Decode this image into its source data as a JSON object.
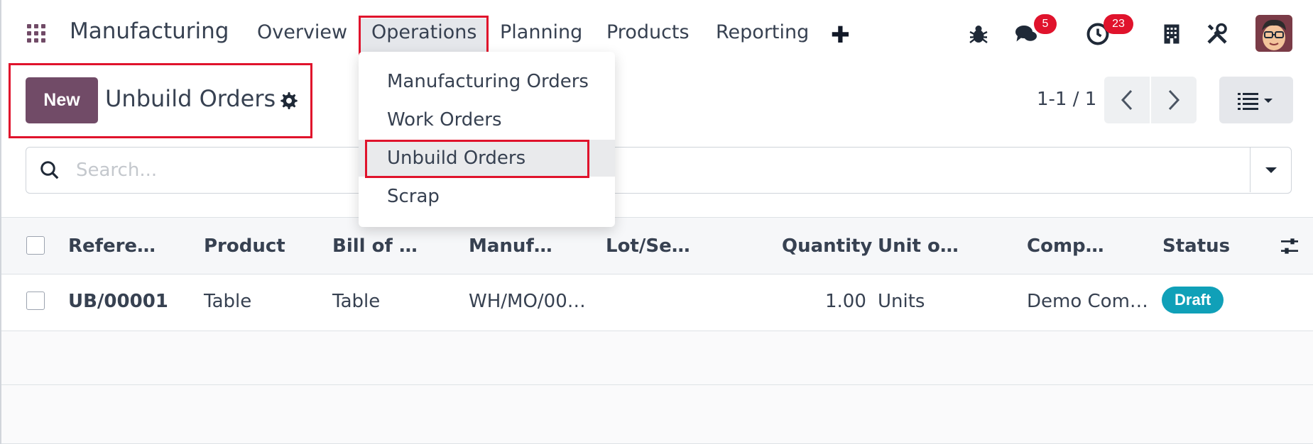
{
  "navbar": {
    "brand": "Manufacturing",
    "menu": [
      "Overview",
      "Operations",
      "Planning",
      "Products",
      "Reporting"
    ],
    "active_menu": "Operations",
    "messages_badge": "5",
    "activities_badge": "23"
  },
  "operations_menu": {
    "items": [
      "Manufacturing Orders",
      "Work Orders",
      "Unbuild Orders",
      "Scrap"
    ],
    "highlighted": "Unbuild Orders"
  },
  "control_panel": {
    "new_label": "New",
    "title": "Unbuild Orders",
    "pager": "1-1 / 1"
  },
  "search": {
    "placeholder": "Search..."
  },
  "table": {
    "columns": [
      "Refere…",
      "Product",
      "Bill of …",
      "Manuf…",
      "Lot/Se…",
      "Quantity",
      "Unit o…",
      "Comp…",
      "Status"
    ],
    "rows": [
      {
        "reference": "UB/00001",
        "product": "Table",
        "bom": "Table",
        "mo": "WH/MO/00…",
        "lot": "",
        "quantity": "1.00",
        "uom": "Units",
        "company": "Demo Com…",
        "status": "Draft"
      }
    ]
  },
  "colors": {
    "brand": "#714b67",
    "badge": "#e0132c",
    "status_draft": "#10a0b8",
    "highlight_border": "#e0132c"
  },
  "icons": [
    "apps-icon",
    "plus-icon",
    "bug-icon",
    "chat-icon",
    "clock-icon",
    "building-icon",
    "tools-icon",
    "gear-icon",
    "search-icon",
    "caret-down-icon",
    "chevron-left-icon",
    "chevron-right-icon",
    "list-view-icon",
    "optional-columns-icon"
  ]
}
